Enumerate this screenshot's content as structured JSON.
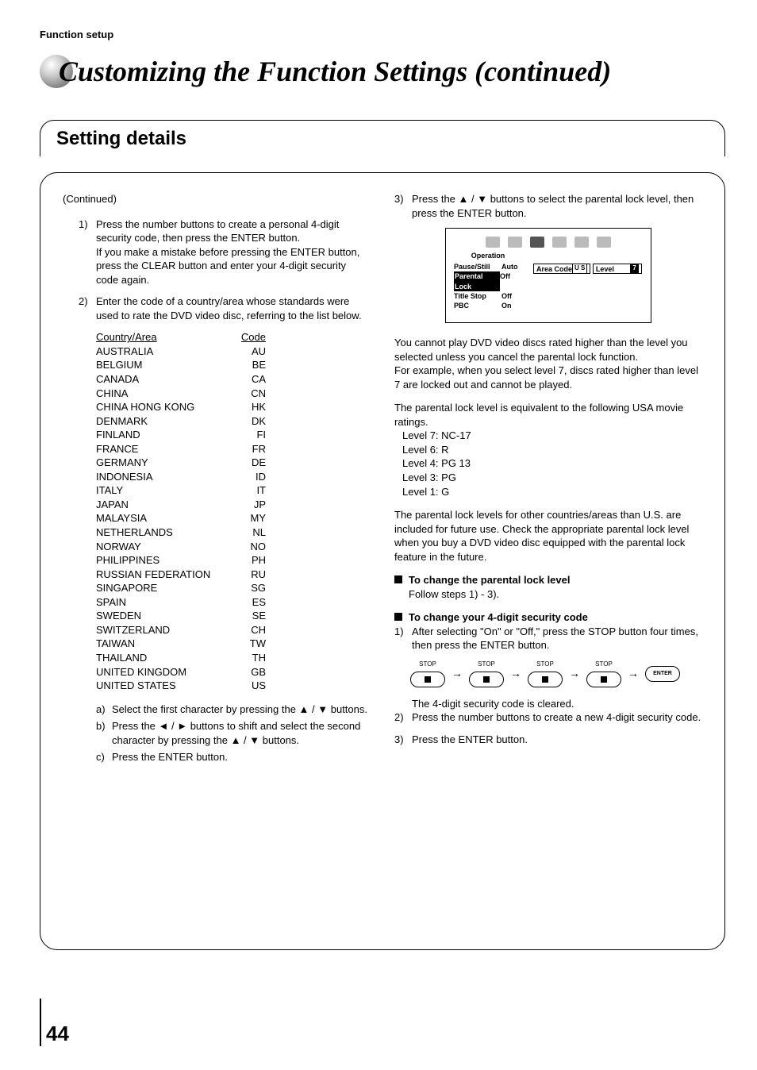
{
  "header": {
    "section_label": "Function setup"
  },
  "title": "Customizing the Function Settings (continued)",
  "section_heading": "Setting details",
  "left": {
    "continued": "(Continued)",
    "step1": {
      "num": "1)",
      "text": "Press the number buttons to create a personal 4-digit security code, then press the ENTER button.",
      "note": "If you make a mistake before pressing the ENTER button, press the CLEAR button and enter your 4-digit security code again."
    },
    "step2": {
      "num": "2)",
      "text": "Enter the code of a country/area whose standards were used to rate the DVD video disc, referring to the list below."
    },
    "table_head": {
      "country": "Country/Area",
      "code": "Code"
    },
    "countries": [
      {
        "name": "AUSTRALIA",
        "code": "AU"
      },
      {
        "name": "BELGIUM",
        "code": "BE"
      },
      {
        "name": "CANADA",
        "code": "CA"
      },
      {
        "name": "CHINA",
        "code": "CN"
      },
      {
        "name": "CHINA HONG KONG",
        "code": "HK"
      },
      {
        "name": "DENMARK",
        "code": "DK"
      },
      {
        "name": "FINLAND",
        "code": "FI"
      },
      {
        "name": "FRANCE",
        "code": "FR"
      },
      {
        "name": "GERMANY",
        "code": "DE"
      },
      {
        "name": "INDONESIA",
        "code": "ID"
      },
      {
        "name": "ITALY",
        "code": "IT"
      },
      {
        "name": "JAPAN",
        "code": "JP"
      },
      {
        "name": "MALAYSIA",
        "code": "MY"
      },
      {
        "name": "NETHERLANDS",
        "code": "NL"
      },
      {
        "name": "NORWAY",
        "code": "NO"
      },
      {
        "name": "PHILIPPINES",
        "code": "PH"
      },
      {
        "name": "RUSSIAN FEDERATION",
        "code": "RU"
      },
      {
        "name": "SINGAPORE",
        "code": "SG"
      },
      {
        "name": "SPAIN",
        "code": "ES"
      },
      {
        "name": "SWEDEN",
        "code": "SE"
      },
      {
        "name": "SWITZERLAND",
        "code": "CH"
      },
      {
        "name": "TAIWAN",
        "code": "TW"
      },
      {
        "name": "THAILAND",
        "code": "TH"
      },
      {
        "name": "UNITED KINGDOM",
        "code": "GB"
      },
      {
        "name": "UNITED STATES",
        "code": "US"
      }
    ],
    "sub_a": {
      "label": "a)",
      "text": "Select the first character by pressing the ▲ / ▼ buttons."
    },
    "sub_b": {
      "label": "b)",
      "text": "Press the ◄ / ► buttons to shift and select the second character by pressing the ▲ / ▼ buttons."
    },
    "sub_c": {
      "label": "c)",
      "text": "Press the ENTER button."
    }
  },
  "right": {
    "step3": {
      "num": "3)",
      "text": "Press the ▲ / ▼ buttons to select the parental lock level, then press the ENTER button."
    },
    "screen": {
      "title": "Operation",
      "rows": [
        {
          "label": "Pause/Still",
          "value": "Auto"
        },
        {
          "label": "Parental Lock",
          "value": "Off",
          "selected": true
        },
        {
          "label": "Title Stop",
          "value": "Off"
        },
        {
          "label": "PBC",
          "value": "On"
        }
      ],
      "right_rows": [
        {
          "label": "Area Code",
          "value": "U S"
        },
        {
          "label": "Level",
          "value": "7",
          "sel": true
        }
      ]
    },
    "para1": "You cannot play DVD video discs rated higher than the level you selected unless you cancel the parental lock function.",
    "para1b": "For example, when you select level 7, discs rated higher than level 7 are locked out and cannot be played.",
    "para2_intro": "The parental lock level is equivalent to the following USA movie ratings.",
    "levels": [
      "Level 7: NC-17",
      "Level 6: R",
      "Level 4: PG 13",
      "Level 3: PG",
      "Level 1: G"
    ],
    "para3": "The parental lock levels for other countries/areas than U.S. are included for future use. Check the appropriate parental lock level when you buy a DVD video disc equipped with the parental lock feature in the future.",
    "bullet1": {
      "title": "To change the parental lock level",
      "body": "Follow steps 1) - 3)."
    },
    "bullet2": {
      "title": "To change your 4-digit security code"
    },
    "b2_step1": {
      "num": "1)",
      "text": "After selecting \"On\" or \"Off,\" press the STOP button four times, then press the ENTER button."
    },
    "stop_label": "STOP",
    "enter_label": "ENTER",
    "after_seq": "The 4-digit security code is cleared.",
    "b2_step2": {
      "num": "2)",
      "text": "Press the number buttons to create a new 4-digit security code."
    },
    "b2_step3": {
      "num": "3)",
      "text": "Press the ENTER button."
    }
  },
  "page_number": "44"
}
